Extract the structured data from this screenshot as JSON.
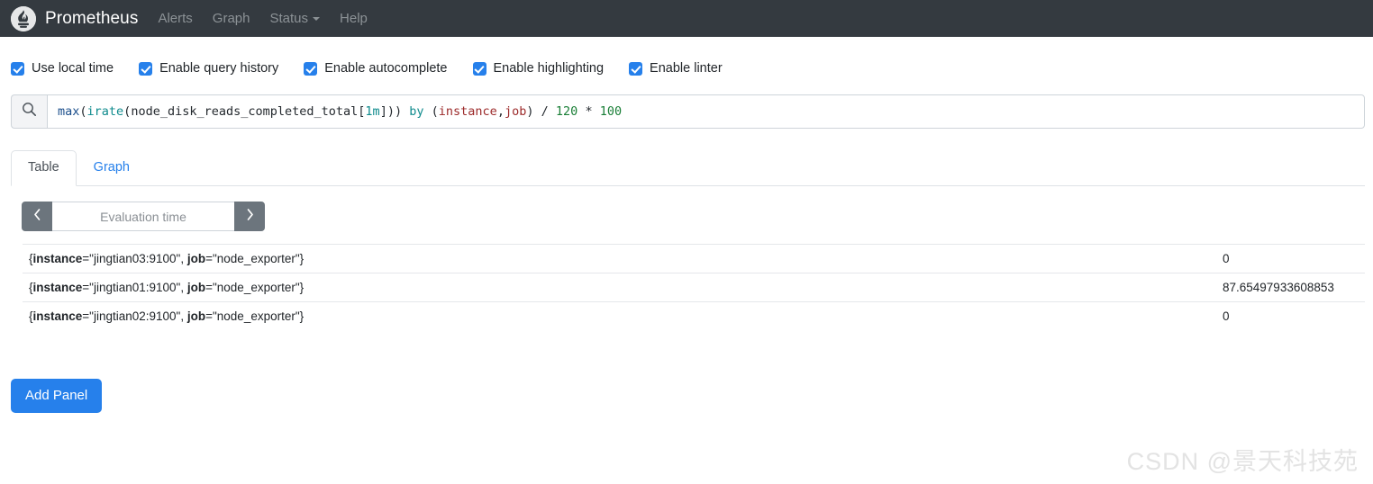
{
  "navbar": {
    "logo_icon": "prometheus-torch-icon",
    "brand": "Prometheus",
    "links": [
      {
        "label": "Alerts",
        "has_caret": false
      },
      {
        "label": "Graph",
        "has_caret": false
      },
      {
        "label": "Status",
        "has_caret": true
      },
      {
        "label": "Help",
        "has_caret": false
      }
    ],
    "background_color": "#343a40",
    "link_color": "#8c9296"
  },
  "options": {
    "accent_color": "#2680eb",
    "items": [
      {
        "label": "Use local time",
        "checked": true
      },
      {
        "label": "Enable query history",
        "checked": true
      },
      {
        "label": "Enable autocomplete",
        "checked": true
      },
      {
        "label": "Enable highlighting",
        "checked": true
      },
      {
        "label": "Enable linter",
        "checked": true
      }
    ]
  },
  "query": {
    "search_icon": "search-icon",
    "expression": "max(irate(node_disk_reads_completed_total[1m])) by (instance,job) / 120 * 100",
    "tokens": [
      {
        "text": "max",
        "type": "fn"
      },
      {
        "text": "(",
        "type": "punc"
      },
      {
        "text": "irate",
        "type": "agg"
      },
      {
        "text": "(",
        "type": "punc"
      },
      {
        "text": "node_disk_reads_completed_total",
        "type": "ident"
      },
      {
        "text": "[",
        "type": "punc"
      },
      {
        "text": "1m",
        "type": "dur"
      },
      {
        "text": "]",
        "type": "punc"
      },
      {
        "text": "))",
        "type": "punc"
      },
      {
        "text": " ",
        "type": "punc"
      },
      {
        "text": "by",
        "type": "kw"
      },
      {
        "text": " ",
        "type": "punc"
      },
      {
        "text": "(",
        "type": "punc"
      },
      {
        "text": "instance",
        "type": "label"
      },
      {
        "text": ",",
        "type": "punc"
      },
      {
        "text": "job",
        "type": "label"
      },
      {
        "text": ")",
        "type": "punc"
      },
      {
        "text": " ",
        "type": "punc"
      },
      {
        "text": "/",
        "type": "op"
      },
      {
        "text": " ",
        "type": "punc"
      },
      {
        "text": "120",
        "type": "num"
      },
      {
        "text": " ",
        "type": "punc"
      },
      {
        "text": "*",
        "type": "op"
      },
      {
        "text": " ",
        "type": "punc"
      },
      {
        "text": "100",
        "type": "num"
      }
    ]
  },
  "tabs": [
    {
      "label": "Table",
      "active": true
    },
    {
      "label": "Graph",
      "active": false
    }
  ],
  "evaluation_time": {
    "prev_icon": "chevron-left-icon",
    "next_icon": "chevron-right-icon",
    "placeholder": "Evaluation time",
    "value": ""
  },
  "results": {
    "rows": [
      {
        "labels": [
          {
            "name": "instance",
            "value": "jingtian03:9100"
          },
          {
            "name": "job",
            "value": "node_exporter"
          }
        ],
        "value": "0"
      },
      {
        "labels": [
          {
            "name": "instance",
            "value": "jingtian01:9100"
          },
          {
            "name": "job",
            "value": "node_exporter"
          }
        ],
        "value": "87.65497933608853"
      },
      {
        "labels": [
          {
            "name": "instance",
            "value": "jingtian02:9100"
          },
          {
            "name": "job",
            "value": "node_exporter"
          }
        ],
        "value": "0"
      }
    ]
  },
  "add_panel": {
    "label": "Add Panel",
    "color": "#2680eb"
  },
  "watermark": {
    "text": "CSDN @景天科技苑"
  }
}
